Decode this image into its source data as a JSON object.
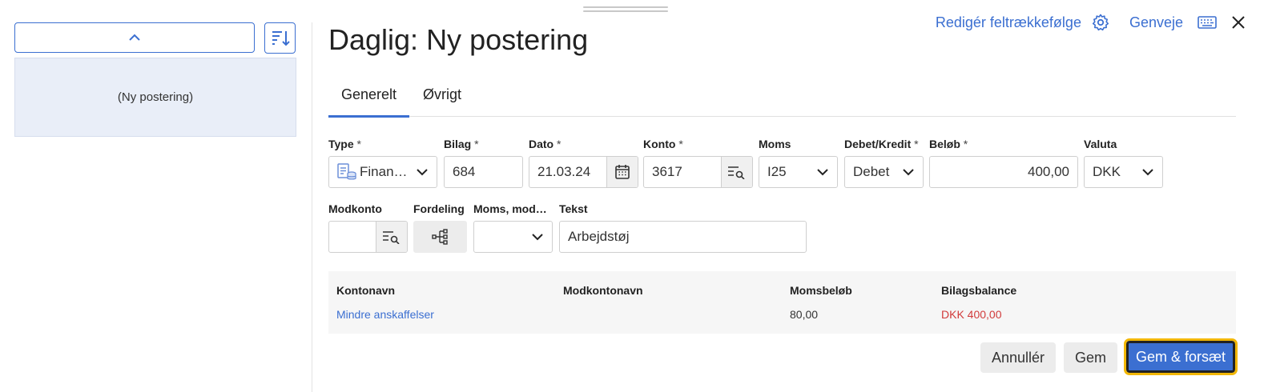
{
  "title": "Daglig: Ny postering",
  "top_actions": {
    "reorder_fields": "Redigér feltrækkefølge",
    "shortcuts": "Genveje"
  },
  "left_panel": {
    "items": [
      {
        "label": "(Ny postering)"
      }
    ]
  },
  "tabs": [
    {
      "label": "Generelt",
      "active": true
    },
    {
      "label": "Øvrigt",
      "active": false
    }
  ],
  "fields": {
    "type": {
      "label": "Type",
      "required": "*",
      "value": "Finan…"
    },
    "bilag": {
      "label": "Bilag",
      "required": "*",
      "value": "684"
    },
    "dato": {
      "label": "Dato",
      "required": "*",
      "value": "21.03.24"
    },
    "konto": {
      "label": "Konto",
      "required": "*",
      "value": "3617"
    },
    "moms": {
      "label": "Moms",
      "value": "I25"
    },
    "debet_kredit": {
      "label": "Debet/Kredit",
      "required": "*",
      "value": "Debet"
    },
    "beloeb": {
      "label": "Beløb",
      "required": "*",
      "value": "400,00"
    },
    "valuta": {
      "label": "Valuta",
      "value": "DKK"
    },
    "modkonto": {
      "label": "Modkonto",
      "value": ""
    },
    "fordeling": {
      "label": "Fordeling"
    },
    "moms_mod": {
      "label": "Moms, mod…",
      "value": ""
    },
    "tekst": {
      "label": "Tekst",
      "value": "Arbejdstøj"
    }
  },
  "info": {
    "headers": [
      "Kontonavn",
      "Modkontonavn",
      "Momsbeløb",
      "Bilagsbalance"
    ],
    "row": {
      "kontonavn": "Mindre anskaffelser",
      "modkontonavn": "",
      "momsbeloeb": "80,00",
      "bilagsbalance": "DKK 400,00"
    }
  },
  "buttons": {
    "cancel": "Annullér",
    "save": "Gem",
    "save_continue": "Gem & forsæt"
  },
  "colors": {
    "accent": "#3b6fd1",
    "negative": "#d13b3b",
    "focus": "#f2b705"
  }
}
